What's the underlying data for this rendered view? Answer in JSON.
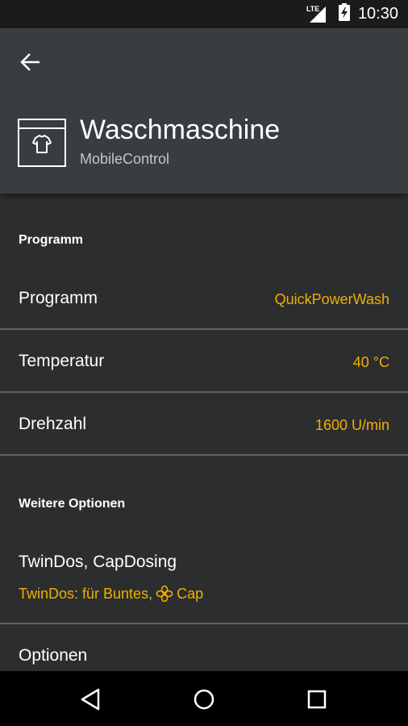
{
  "status": {
    "network": "LTE",
    "time": "10:30"
  },
  "header": {
    "title": "Waschmaschine",
    "subtitle": "MobileControl"
  },
  "sections": {
    "programm": {
      "heading": "Programm",
      "rows": [
        {
          "label": "Programm",
          "value": "QuickPowerWash"
        },
        {
          "label": "Temperatur",
          "value": "40 °C"
        },
        {
          "label": "Drehzahl",
          "value": "1600 U/min"
        }
      ]
    },
    "weitere": {
      "heading": "Weitere Optionen",
      "twindos_label": "TwinDos, CapDosing",
      "twindos_value": "TwinDos: für Buntes,",
      "cap_value": "Cap",
      "optionen_label": "Optionen"
    }
  },
  "colors": {
    "accent": "#f0b000",
    "appbar": "#3a3d3f",
    "background": "#2b2d2f"
  }
}
